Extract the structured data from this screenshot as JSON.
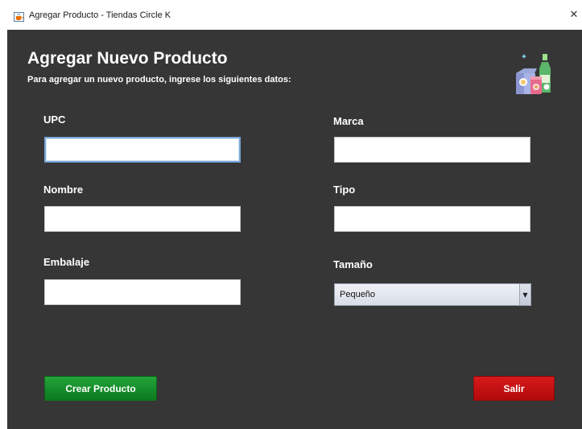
{
  "window": {
    "title": "Agregar Producto - Tiendas Circle K",
    "close_glyph": "✕"
  },
  "header": {
    "title": "Agregar Nuevo Producto",
    "subtitle": "Para agregar un nuevo producto, ingrese los siguientes datos:"
  },
  "form": {
    "upc": {
      "label": "UPC",
      "value": ""
    },
    "nombre": {
      "label": "Nombre",
      "value": ""
    },
    "embalaje": {
      "label": "Embalaje",
      "value": ""
    },
    "marca": {
      "label": "Marca",
      "value": ""
    },
    "tipo": {
      "label": "Tipo",
      "value": ""
    },
    "tamano": {
      "label": "Tamaño",
      "selected": "Pequeño",
      "arrow": "▼"
    }
  },
  "buttons": {
    "create": "Crear Producto",
    "exit": "Salir"
  },
  "icons": {
    "app": "java-cup-icon",
    "products": "grocery-products-icon"
  },
  "colors": {
    "background": "#363636",
    "create_button": "#139a2b",
    "exit_button": "#c8101a"
  }
}
